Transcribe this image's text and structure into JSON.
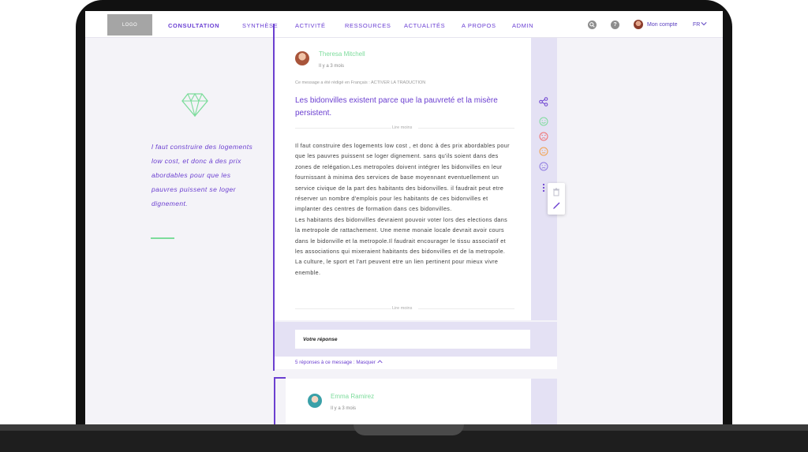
{
  "nav": {
    "logo": "LOGO",
    "links": [
      "CONSULTATION",
      "SYNTHÈSE",
      "ACTIVITÉ",
      "RESSOURCES",
      "ACTUALITÉS",
      "A PROPOS",
      "ADMIN"
    ],
    "account": "Mon compte",
    "language": "FR"
  },
  "quote": {
    "text": "l faut construire des logements low cost, et donc à des prix abordables pour que les pauvres puissent se loger dignement."
  },
  "post": {
    "author": "Theresa Mitchell",
    "time": "Il y a 3 mois",
    "translation_note": "Ce message a été rédigé en Français : ACTIVER LA TRADUCTION",
    "title": "Les bidonvilles existent parce que la pauvreté et la misère persistent.",
    "read_less_top": "Lire moins",
    "read_less_bottom": "Lire moins",
    "body": [
      "Il faut construire des logements low cost , et donc à des prix abordables pour que les pauvres puissent se loger dignement. sans qu'ils soient dans des zones de relégation.Les metropoles doivent intégrer les bidonvilles en leur fournissant à minima des services de base moyennant eventuellement un service civique de la part des habitants des bidonvilles. il faudrait peut etre réserver un nombre d'emplois pour les habitants de ces bidonvilles et implanter des centres de formation dans ces bidonvilles.",
      "Les habitants des bidonvilles devraient pouvoir voter lors des elections dans la metropole de rattachement. Une meme monaie locale devrait avoir cours dans le bidonville et la metropole.Il faudrait encourager le tissu associatif et les associations qui mixeraient habitants des bidonvilles et de la metropole.",
      "La culture, le sport et l'art peuvent etre un lien pertinent pour mieux vivre enemble."
    ]
  },
  "side_icons": [
    "share-icon",
    "smile-green-icon",
    "angry-red-icon",
    "neutral-orange-icon",
    "sad-purple-icon",
    "more-dots-icon"
  ],
  "popover_icons": [
    "trash-icon",
    "pencil-icon"
  ],
  "reply": {
    "placeholder": "Votre réponse",
    "count_text": "5 réponses à ce message",
    "separator": ":",
    "toggle": "Masquer"
  },
  "second_post": {
    "author": "Emma Ramirez",
    "time": "Il y a 3 mois"
  },
  "colors": {
    "accent": "#6b3fd0",
    "green": "#7ddc9c",
    "side_panel": "#e4e1f4"
  }
}
